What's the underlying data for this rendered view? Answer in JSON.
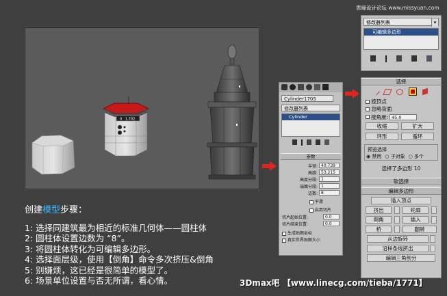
{
  "watermark_top": "思缘设计论坛 www.missyuan.com",
  "viewport": {
    "name": "Perspective viewport",
    "axis_values": [
      "0",
      "1.702"
    ]
  },
  "tutorial": {
    "title_prefix": "创建",
    "title_highlight": "模型",
    "title_suffix": "步骤：",
    "steps": [
      "1: 选择同建筑最为相近的标准几何体——圆柱体",
      "2: 圆柱体设置边数为 “8”。",
      "3: 将圆柱体转化为可编辑多边形。",
      "4: 选择面层级，使用【倒角】命令多次挤压&倒角",
      "5: 别嫌烦，这已经是很简单的模型了。",
      "6: 场景单位设置与否无所谓，看心情。"
    ],
    "footer": "3Dmax吧 【www.linecg.com/tieba/1771】"
  },
  "mid_panel": {
    "object_name": "Cylinder1705",
    "modifier_list": "修改器列表",
    "stack_item": "Cylinder",
    "params_header": "参数",
    "params": [
      {
        "label": "半径:",
        "value": "40.739"
      },
      {
        "label": "高度:",
        "value": "53.215"
      },
      {
        "label": "高度分段:",
        "value": "1"
      },
      {
        "label": "端面分段:",
        "value": "1"
      },
      {
        "label": "边数:",
        "value": "8"
      }
    ],
    "smooth": "平滑",
    "slice_on": "启用切片",
    "slice_from": {
      "label": "切片起始位置:",
      "value": "0.0"
    },
    "slice_to": {
      "label": "切片结束位置:",
      "value": "0.0"
    },
    "gen_map": "生成贴图坐标",
    "real_world": "真实世界贴图大小"
  },
  "right_panel": {
    "modifier_list": "修改器列表",
    "stack_item": "可编辑多边形",
    "selection_header": "选择",
    "by_vertex": "按顶点",
    "ignore_backface": "忽略背面",
    "by_angle": {
      "label": "按角度:",
      "value": "45.0"
    },
    "shrink": "收缩",
    "grow": "扩大",
    "ring": "环形",
    "loop": "循环",
    "preview_label": "预览选择",
    "preview_options": [
      "禁用",
      "子对象",
      "多个"
    ],
    "status": "选择了多边形 10",
    "soft_header": "软选择",
    "edit_poly_header": "编辑多边形",
    "insert_vertex": "插入顶点",
    "row1": [
      "挤出",
      "轮廓"
    ],
    "row2": [
      "倒角",
      "插入"
    ],
    "row3": [
      "桥",
      "翻转"
    ],
    "hinge": "从边旋转",
    "extrude_spline": "沿样条线挤出",
    "edit_tri": "编辑三角剖分"
  },
  "colors": {
    "background": "#3f3f3f",
    "highlight_text": "#39b6ff",
    "arrow": "#e0241f",
    "selected_face": "#c61a1a",
    "polygon_button": "#ffd800"
  }
}
